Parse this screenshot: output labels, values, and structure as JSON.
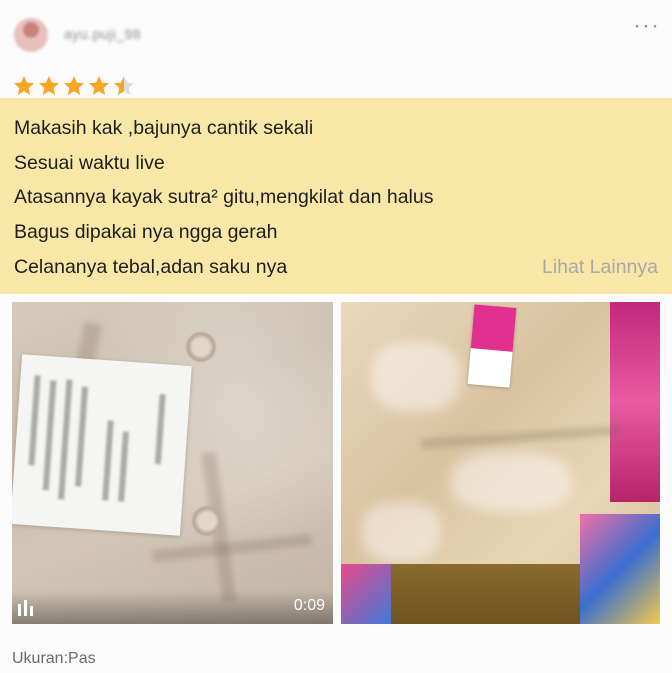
{
  "header": {
    "username": "ayu.puji_98",
    "more_label": "···"
  },
  "rating": {
    "value": 4.5,
    "max": 5
  },
  "review": {
    "lines": [
      "Makasih kak ,bajunya cantik sekali",
      "Sesuai waktu live",
      "Atasannya kayak sutra² gitu,mengkilat dan halus",
      "Bagus dipakai nya ngga gerah",
      "Celananya tebal,adan saku nya"
    ],
    "see_more": "Lihat Lainnya"
  },
  "media": {
    "video_duration": "0:09",
    "video_icon": "video-icon"
  },
  "variant": {
    "label": "Ukuran:Pas"
  },
  "colors": {
    "star": "#f5a623",
    "highlight": "#f9e7a8",
    "see_more": "#a8a8a8"
  }
}
